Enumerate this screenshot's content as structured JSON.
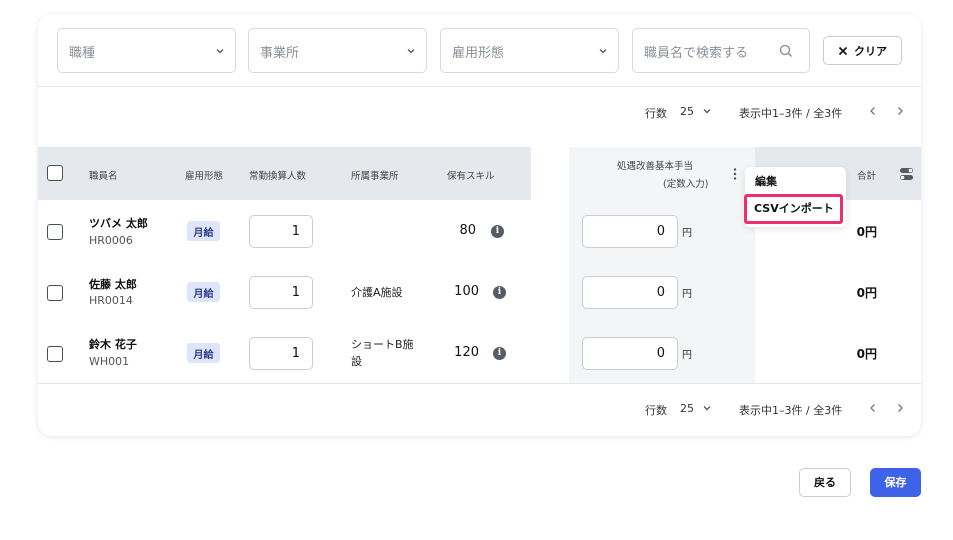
{
  "filters": {
    "job_type_placeholder": "職種",
    "office_placeholder": "事業所",
    "employment_placeholder": "雇用形態",
    "search_placeholder": "職員名で検索する",
    "clear_label": "クリア"
  },
  "pagination_top": {
    "rows_label": "行数",
    "rows_value": "25",
    "range_text": "表示中1–3件 / 全3件"
  },
  "pagination_bottom": {
    "rows_label": "行数",
    "rows_value": "25",
    "range_text": "表示中1–3件 / 全3件"
  },
  "table": {
    "headers": {
      "name": "職員名",
      "employment": "雇用形態",
      "fte": "常勤換算人数",
      "office": "所属事業所",
      "skill": "保有スキル",
      "allowance_line1": "処遇改善基本手当",
      "allowance_line2": "(定数入力)",
      "total": "合計"
    },
    "rows": [
      {
        "name": "ツバメ 太郎",
        "code": "HR0006",
        "employment": "月給",
        "fte": "1",
        "office": "",
        "skill": "80",
        "allowance": "0",
        "yen": "円",
        "total": "0円"
      },
      {
        "name": "佐藤 太郎",
        "code": "HR0014",
        "employment": "月給",
        "fte": "1",
        "office": "介護A施設",
        "skill": "100",
        "allowance": "0",
        "yen": "円",
        "total": "0円"
      },
      {
        "name": "鈴木 花子",
        "code": "WH001",
        "employment": "月給",
        "fte": "1",
        "office": "ショートB施設",
        "skill": "120",
        "allowance": "0",
        "yen": "円",
        "total": "0円"
      }
    ]
  },
  "column_menu": {
    "edit_label": "編集",
    "csv_import_label": "CSVインポート",
    "highlight_color": "#ea2f6a"
  },
  "footer": {
    "back_label": "戻る",
    "save_label": "保存",
    "save_color": "#3f63e8"
  }
}
